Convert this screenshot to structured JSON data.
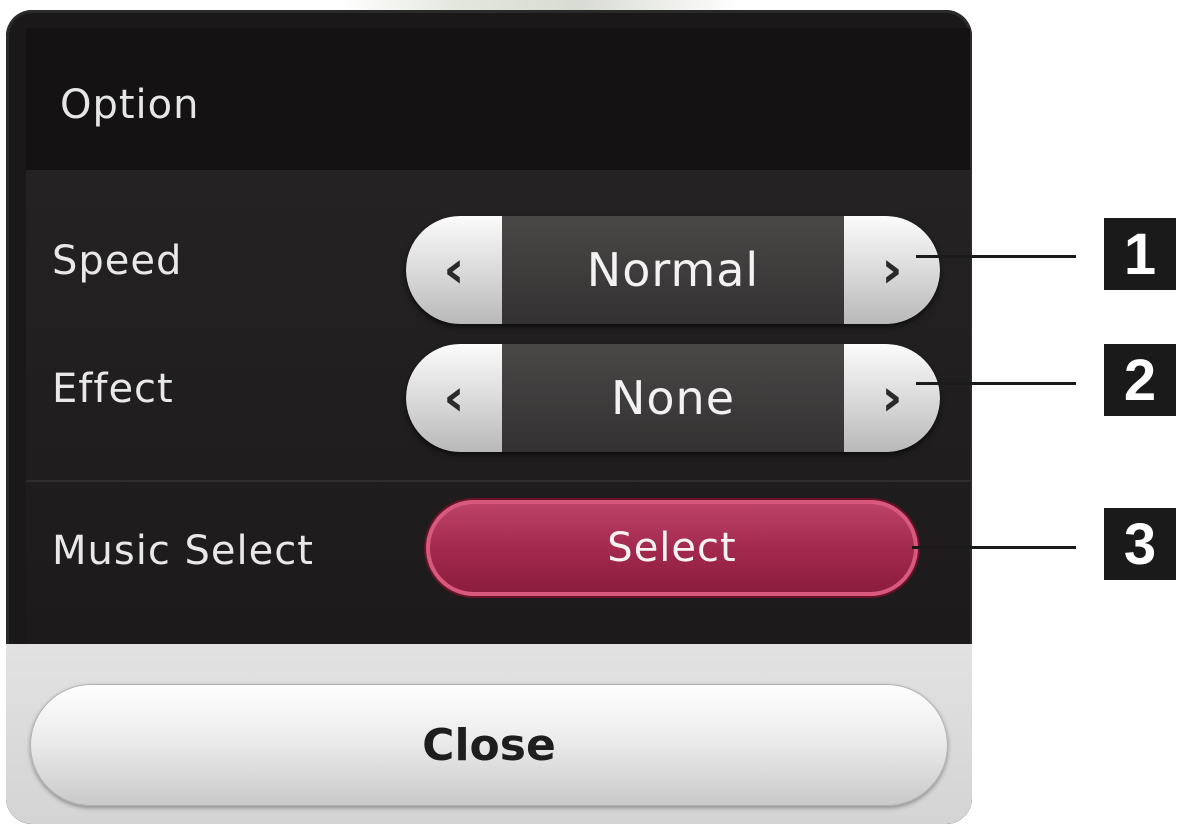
{
  "dialog": {
    "title": "Option"
  },
  "rows": [
    {
      "label": "Speed",
      "value": "Normal",
      "left_arrow": "‹",
      "right_arrow": "›"
    },
    {
      "label": "Effect",
      "value": "None",
      "left_arrow": "‹",
      "right_arrow": "›"
    },
    {
      "label": "Music Select",
      "button": "Select"
    }
  ],
  "footer": {
    "close_label": "Close"
  },
  "callouts": [
    "1",
    "2",
    "3"
  ],
  "icons": {
    "left": "chevron-left-icon",
    "right": "chevron-right-icon"
  },
  "colors": {
    "panel": "#1e1c1c",
    "select_accent": "#a0284c",
    "footer": "#d4d4d4"
  }
}
